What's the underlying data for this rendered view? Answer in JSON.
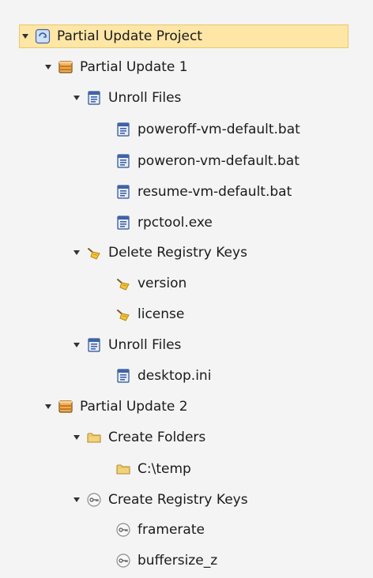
{
  "tree": {
    "root": {
      "label": "Partial Update Project",
      "selected": true,
      "icon": "refresh-project-icon"
    },
    "update1": {
      "label": "Partial Update 1",
      "icon": "package-icon"
    },
    "unroll1": {
      "label": "Unroll Files",
      "icon": "document-icon"
    },
    "files1": [
      {
        "label": "poweroff-vm-default.bat"
      },
      {
        "label": "poweron-vm-default.bat"
      },
      {
        "label": "resume-vm-default.bat"
      },
      {
        "label": "rpctool.exe"
      }
    ],
    "delete_keys": {
      "label": "Delete Registry Keys",
      "icon": "broom-icon"
    },
    "deleted": [
      {
        "label": "version"
      },
      {
        "label": "license"
      }
    ],
    "unroll2": {
      "label": "Unroll Files",
      "icon": "document-icon"
    },
    "files2": [
      {
        "label": "desktop.ini"
      }
    ],
    "update2": {
      "label": "Partial Update 2",
      "icon": "package-icon"
    },
    "create_folders": {
      "label": "Create Folders",
      "icon": "folder-icon"
    },
    "folders": [
      {
        "label": "C:\\temp"
      }
    ],
    "create_keys": {
      "label": "Create Registry Keys",
      "icon": "key-icon"
    },
    "keys": [
      {
        "label": "framerate"
      },
      {
        "label": "buffersize_z"
      }
    ]
  },
  "colors": {
    "selection_bg": "#fde6a6",
    "selection_border": "#e8c96a",
    "document_blue": "#4a6fb5",
    "folder_yellow": "#f2d27a",
    "package_orange": "#e7a24b"
  }
}
